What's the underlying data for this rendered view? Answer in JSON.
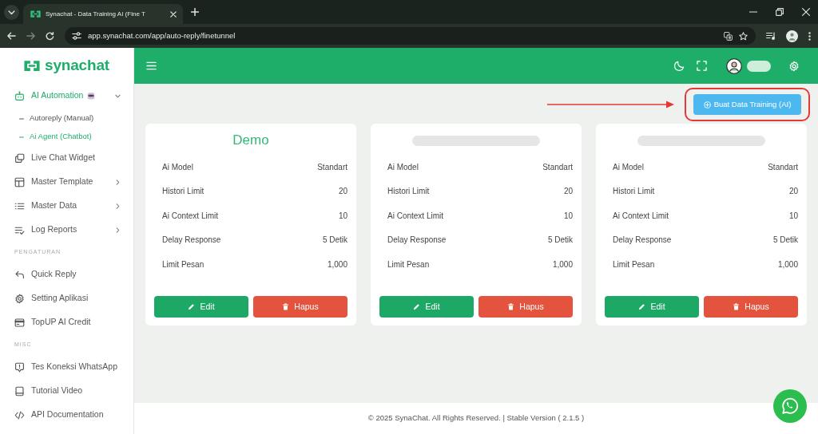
{
  "browser": {
    "tab": {
      "title": "Synachat - Data Training AI (Fine T"
    },
    "address": "app.synachat.com/app/auto-reply/finetunnel"
  },
  "sidebar": {
    "logo": "synachat",
    "sections": [
      {
        "items": [
          {
            "label": "AI Automation",
            "selected": true,
            "expanded": true,
            "children": [
              {
                "label": "Autoreply (Manual)",
                "selected": false
              },
              {
                "label": "Ai Agent (Chatbot)",
                "selected": true
              }
            ]
          },
          {
            "label": "Live Chat Widget",
            "selected": false
          },
          {
            "label": "Master Template",
            "selected": false,
            "expanded": false
          },
          {
            "label": "Master Data",
            "selected": false,
            "expanded": false
          },
          {
            "label": "Log Reports",
            "selected": false,
            "expanded": false
          }
        ]
      },
      {
        "heading": "PENGATURAN",
        "items": [
          {
            "label": "Quick Reply",
            "selected": false
          },
          {
            "label": "Setting Aplikasi",
            "selected": false
          },
          {
            "label": "TopUP AI Credit",
            "selected": false
          }
        ]
      },
      {
        "heading": "MISC",
        "items": [
          {
            "label": "Tes Koneksi WhatsApp",
            "selected": false
          },
          {
            "label": "Tutorial Video",
            "selected": false
          },
          {
            "label": "API Documentation",
            "selected": false
          }
        ]
      }
    ]
  },
  "toolbar": {
    "create_button": {
      "label": "Buat Data Training (AI)",
      "highlighted": true
    }
  },
  "cards": [
    {
      "title": "Demo",
      "blurred": false,
      "rows": [
        {
          "label": "Ai Model",
          "value": "Standart"
        },
        {
          "label": "Histori Limit",
          "value": "20"
        },
        {
          "label": "Ai Context Limit",
          "value": "10"
        },
        {
          "label": "Delay Response",
          "value": "5 Detik"
        },
        {
          "label": "Limit Pesan",
          "value": "1,000"
        }
      ],
      "buttons": [
        {
          "kind": "edit",
          "label": "Edit"
        },
        {
          "kind": "delete",
          "label": "Hapus"
        }
      ]
    },
    {
      "blurred": true,
      "rows": [
        {
          "label": "Ai Model",
          "value": "Standart"
        },
        {
          "label": "Histori Limit",
          "value": "20"
        },
        {
          "label": "Ai Context Limit",
          "value": "10"
        },
        {
          "label": "Delay Response",
          "value": "5 Detik"
        },
        {
          "label": "Limit Pesan",
          "value": "1,000"
        }
      ],
      "buttons": [
        {
          "kind": "edit",
          "label": "Edit"
        },
        {
          "kind": "delete",
          "label": "Hapus"
        }
      ]
    },
    {
      "blurred": true,
      "rows": [
        {
          "label": "Ai Model",
          "value": "Standart"
        },
        {
          "label": "Histori Limit",
          "value": "20"
        },
        {
          "label": "Ai Context Limit",
          "value": "10"
        },
        {
          "label": "Delay Response",
          "value": "5 Detik"
        },
        {
          "label": "Limit Pesan",
          "value": "1,000"
        }
      ],
      "buttons": [
        {
          "kind": "edit",
          "label": "Edit"
        },
        {
          "kind": "delete",
          "label": "Hapus"
        }
      ]
    }
  ],
  "footer": {
    "text": "© 2025 SynaChat. All Rights Reserved. | Stable Version ( 2.1.5 )"
  }
}
